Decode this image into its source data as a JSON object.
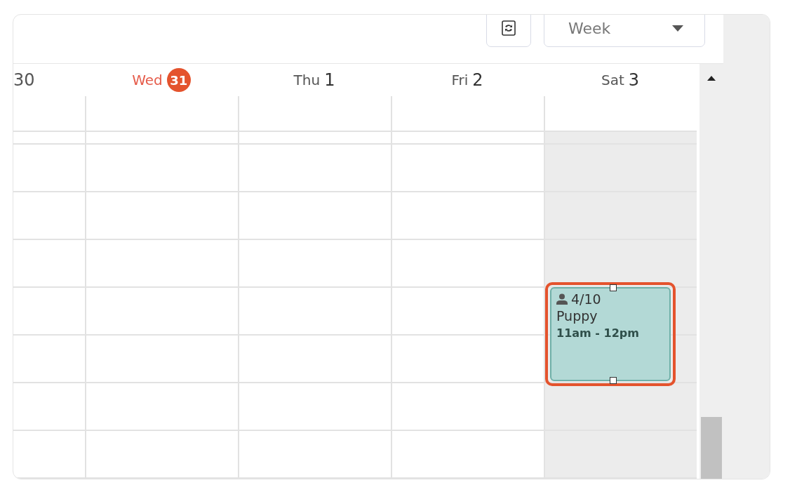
{
  "toolbar": {
    "view": "Week"
  },
  "days": [
    {
      "number": "30",
      "today": false,
      "weekend": false
    },
    {
      "name": "Wed",
      "number": "31",
      "today": true,
      "weekend": false
    },
    {
      "name": "Thu",
      "number": "1",
      "today": false,
      "weekend": false
    },
    {
      "name": "Fri",
      "number": "2",
      "today": false,
      "weekend": false
    },
    {
      "name": "Sat",
      "number": "3",
      "today": false,
      "weekend": true,
      "events": [
        {
          "count": "4/10",
          "title": "Puppy",
          "time": "11am - 12pm",
          "selected": true
        }
      ]
    }
  ]
}
